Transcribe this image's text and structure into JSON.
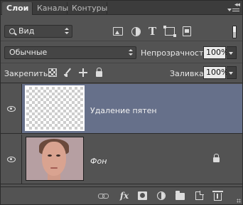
{
  "tabs": [
    {
      "label": "Слои",
      "active": true
    },
    {
      "label": "Каналы",
      "active": false
    },
    {
      "label": "Контуры",
      "active": false
    }
  ],
  "panel_controls": {
    "close_glyph": "◂◂"
  },
  "filter": {
    "kind_label": "Вид",
    "icons": [
      "image-filter-icon",
      "adjustment-filter-icon",
      "type-filter-icon",
      "shape-filter-icon",
      "smart-object-filter-icon"
    ]
  },
  "blend": {
    "mode": "Обычные",
    "opacity_label": "Непрозрачность:",
    "opacity_value": "100%"
  },
  "lock": {
    "label": "Закрепить:",
    "fill_label": "Заливка:",
    "fill_value": "100%"
  },
  "layers": [
    {
      "name": "Удаление пятен",
      "visible": true,
      "selected": true,
      "thumbnail": "transparent",
      "locked": false
    },
    {
      "name": "Фон",
      "visible": true,
      "selected": false,
      "thumbnail": "portrait-photo",
      "locked": true,
      "italic": true
    }
  ],
  "bottom_bar": {
    "fx_label": "fx",
    "icons": [
      "link-layers-icon",
      "fx-icon",
      "layer-mask-icon",
      "adjustment-layer-icon",
      "group-folder-icon",
      "new-layer-icon",
      "trash-icon"
    ]
  },
  "colors": {
    "panel_bg": "#535353",
    "tabbar_bg": "#3c3c3c",
    "selected_layer_bg": "#66708a",
    "input_bg": "#e9e9e9"
  }
}
